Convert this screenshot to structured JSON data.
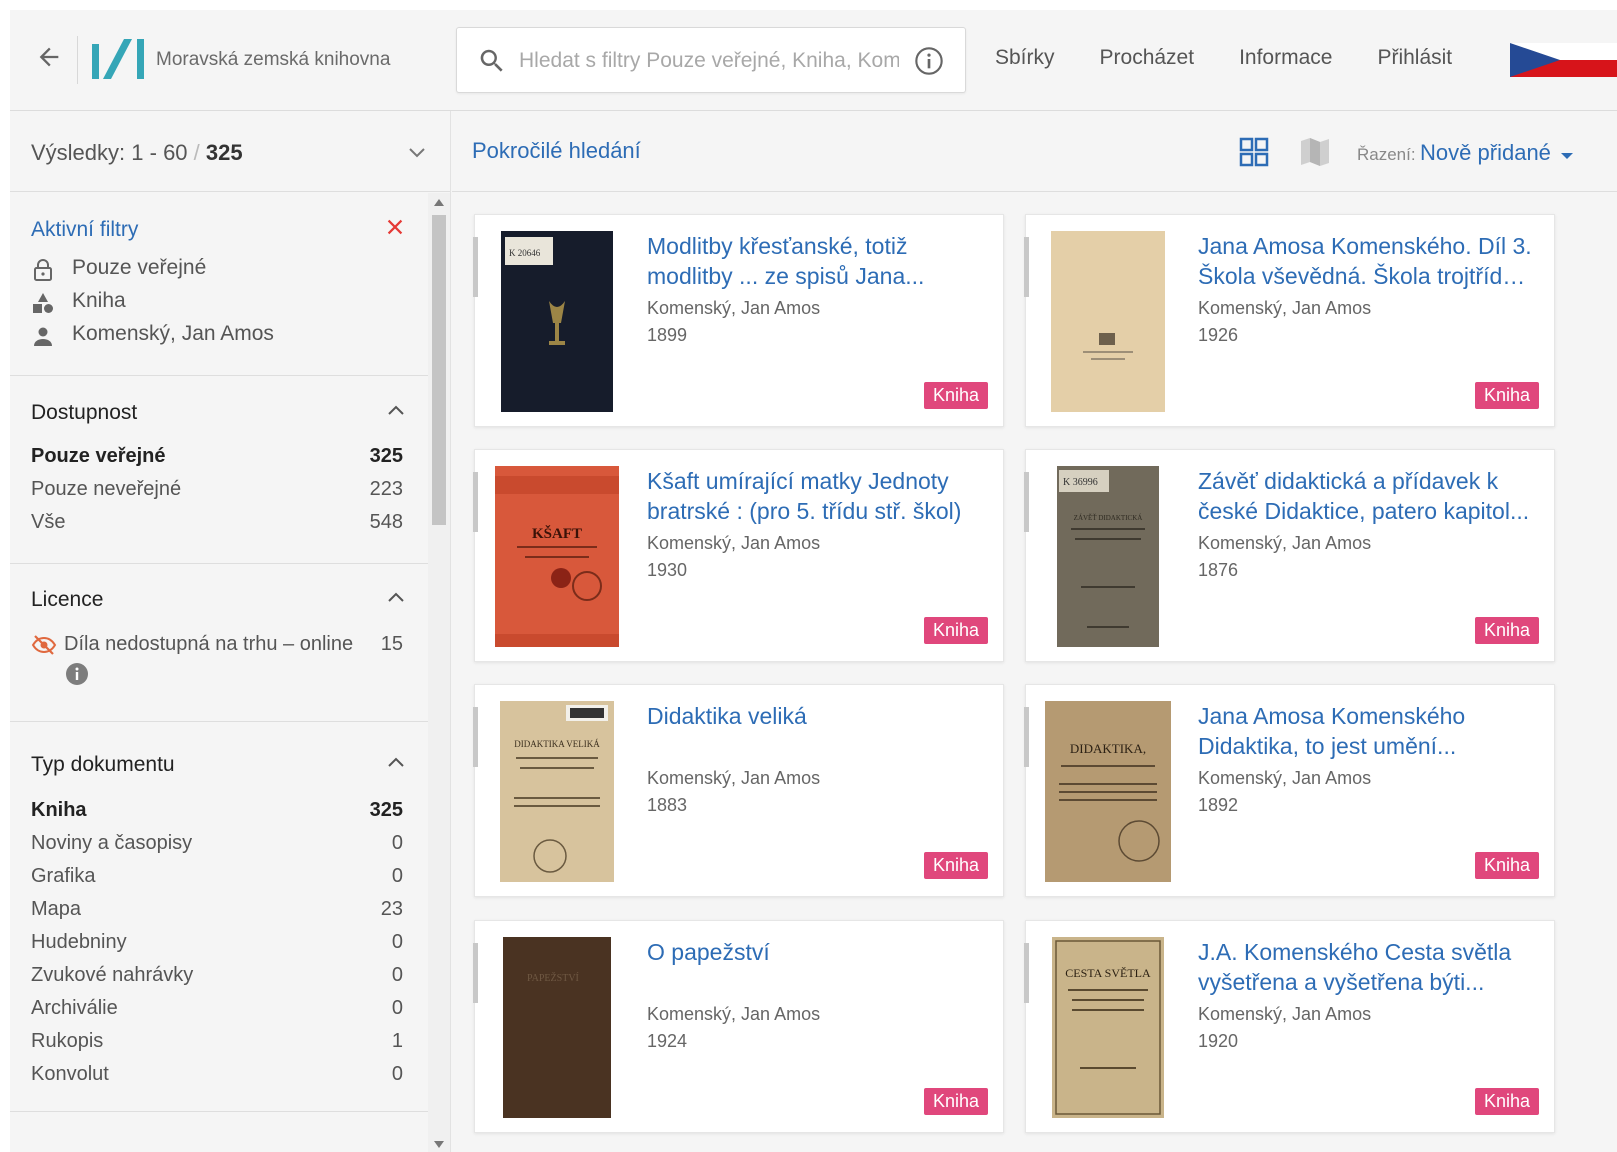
{
  "header": {
    "library_name": "Moravská zemská knihovna",
    "search_placeholder": "Hledat s filtry Pouze veřejné, Kniha, Komenský, Jan Amos",
    "nav": [
      "Sbírky",
      "Procházet",
      "Informace",
      "Přihlásit"
    ],
    "icons": {
      "back": "arrow-left-icon",
      "search": "search-icon",
      "info": "info-circle-icon"
    },
    "colors": {
      "logo": "#35a6b7",
      "flag_blue": "#254a95",
      "flag_red": "#d7141a"
    }
  },
  "results": {
    "label": "Výsledky:",
    "range": "1 - 60",
    "separator": "/",
    "total": "325"
  },
  "active_filters": {
    "title": "Aktivní filtry",
    "items": [
      {
        "icon": "lock-icon",
        "label": "Pouze veřejné"
      },
      {
        "icon": "shapes-icon",
        "label": "Kniha"
      },
      {
        "icon": "person-icon",
        "label": "Komenský, Jan Amos"
      }
    ]
  },
  "facets": {
    "availability": {
      "title": "Dostupnost",
      "rows": [
        {
          "label": "Pouze veřejné",
          "count": "325",
          "selected": true
        },
        {
          "label": "Pouze neveřejné",
          "count": "223",
          "selected": false
        },
        {
          "label": "Vše",
          "count": "548",
          "selected": false
        }
      ]
    },
    "license": {
      "title": "Licence",
      "rows": [
        {
          "label": "Díla nedostupná na trhu – online",
          "count": "15"
        }
      ]
    },
    "doc_type": {
      "title": "Typ dokumentu",
      "rows": [
        {
          "label": "Kniha",
          "count": "325",
          "selected": true
        },
        {
          "label": "Noviny a časopisy",
          "count": "0",
          "selected": false
        },
        {
          "label": "Grafika",
          "count": "0",
          "selected": false
        },
        {
          "label": "Mapa",
          "count": "23",
          "selected": false
        },
        {
          "label": "Hudebniny",
          "count": "0",
          "selected": false
        },
        {
          "label": "Zvukové nahrávky",
          "count": "0",
          "selected": false
        },
        {
          "label": "Archiválie",
          "count": "0",
          "selected": false
        },
        {
          "label": "Rukopis",
          "count": "1",
          "selected": false
        },
        {
          "label": "Konvolut",
          "count": "0",
          "selected": false
        }
      ]
    }
  },
  "toolbar": {
    "advanced_search": "Pokročilé hledání",
    "sort_label": "Řazení:",
    "sort_value": "Nově přidané"
  },
  "cards": [
    {
      "title_line1": "Modlitby křesťanské, totiž",
      "title_line2": "modlitby ... ze spisů Jana...",
      "author": "Komenský, Jan Amos",
      "year": "1899",
      "badge": "Kniha",
      "cover_label": "",
      "cover_id": "K 20646"
    },
    {
      "title_line1": "Jana Amosa Komenského. Díl 3.",
      "title_line2": "Škola vševědná. Škola trojtřídn...",
      "author": "Komenský, Jan Amos",
      "year": "1926",
      "badge": "Kniha",
      "cover_label": "",
      "cover_id": ""
    },
    {
      "title_line1": "Kšaft umírající matky Jednoty",
      "title_line2": "bratrské : (pro 5. třídu stř. škol)",
      "author": "Komenský, Jan Amos",
      "year": "1930",
      "badge": "Kniha",
      "cover_label": "KŠAFT",
      "cover_id": ""
    },
    {
      "title_line1": "Závěť didaktická a přídavek k",
      "title_line2": "české Didaktice, patero kapitol...",
      "author": "Komenský, Jan Amos",
      "year": "1876",
      "badge": "Kniha",
      "cover_label": "ZÁVĚŤ DIDAKTICKÁ",
      "cover_id": "K 36996"
    },
    {
      "title_line1": "Didaktika veliká",
      "title_line2": "",
      "author": "Komenský, Jan Amos",
      "year": "1883",
      "badge": "Kniha",
      "cover_label": "DIDAKTIKA VELIKÁ",
      "cover_id": ""
    },
    {
      "title_line1": "Jana Amosa Komenského",
      "title_line2": "Didaktika, to jest umění...",
      "author": "Komenský, Jan Amos",
      "year": "1892",
      "badge": "Kniha",
      "cover_label": "DIDAKTIKA,",
      "cover_id": ""
    },
    {
      "title_line1": "O papežství",
      "title_line2": "",
      "author": "Komenský, Jan Amos",
      "year": "1924",
      "badge": "Kniha",
      "cover_label": "PAPEŽSTVÍ",
      "cover_id": ""
    },
    {
      "title_line1": "J.A. Komenského Cesta světla",
      "title_line2": "vyšetřena a vyšetřena býti...",
      "author": "Komenský, Jan Amos",
      "year": "1920",
      "badge": "Kniha",
      "cover_label": "CESTA SVĚTLA",
      "cover_id": ""
    }
  ],
  "colors": {
    "link": "#2d6cb5",
    "badge": "#e0477c",
    "clear": "#e53935"
  }
}
